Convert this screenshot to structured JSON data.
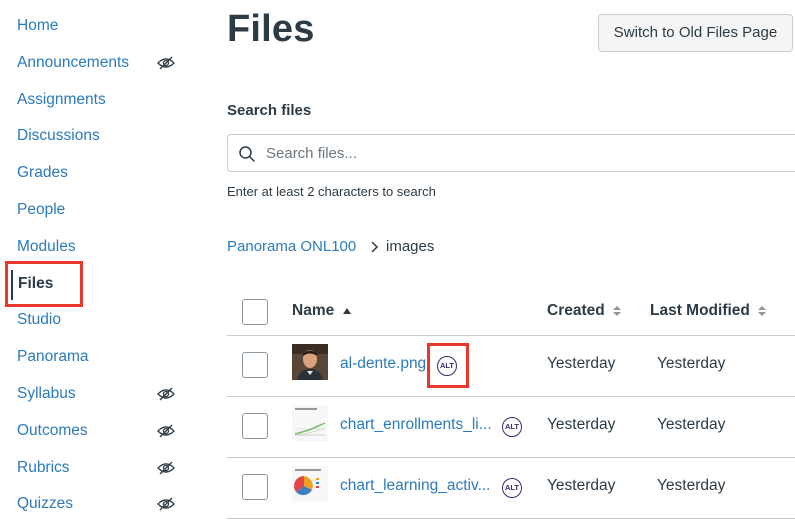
{
  "sidebar": {
    "items": [
      {
        "label": "Home",
        "hidden": false
      },
      {
        "label": "Announcements",
        "hidden": true
      },
      {
        "label": "Assignments",
        "hidden": false
      },
      {
        "label": "Discussions",
        "hidden": false
      },
      {
        "label": "Grades",
        "hidden": false
      },
      {
        "label": "People",
        "hidden": false
      },
      {
        "label": "Modules",
        "hidden": false
      },
      {
        "label": "Files",
        "hidden": false,
        "active": true
      },
      {
        "label": "Studio",
        "hidden": false
      },
      {
        "label": "Panorama",
        "hidden": false
      },
      {
        "label": "Syllabus",
        "hidden": true
      },
      {
        "label": "Outcomes",
        "hidden": true
      },
      {
        "label": "Rubrics",
        "hidden": true
      },
      {
        "label": "Quizzes",
        "hidden": true
      }
    ]
  },
  "header": {
    "title": "Files",
    "old_files_button": "Switch to Old Files Page"
  },
  "search": {
    "label": "Search files",
    "placeholder": "Search files...",
    "value": "",
    "hint": "Enter at least 2 characters to search"
  },
  "breadcrumb": {
    "parent": "Panorama ONL100",
    "current": "images"
  },
  "table": {
    "columns": {
      "name": "Name",
      "created": "Created",
      "modified": "Last Modified"
    },
    "rows": [
      {
        "name": "al-dente.png",
        "alt_badge": "ALT",
        "created": "Yesterday",
        "modified": "Yesterday"
      },
      {
        "name": "chart_enrollments_li...",
        "alt_badge": "ALT",
        "created": "Yesterday",
        "modified": "Yesterday"
      },
      {
        "name": "chart_learning_activ...",
        "alt_badge": "ALT",
        "created": "Yesterday",
        "modified": "Yesterday"
      }
    ]
  },
  "colors": {
    "link": "#2b7abc",
    "text": "#2d3b45",
    "highlight": "#e8372c",
    "alt_badge": "#3a2a6b"
  }
}
